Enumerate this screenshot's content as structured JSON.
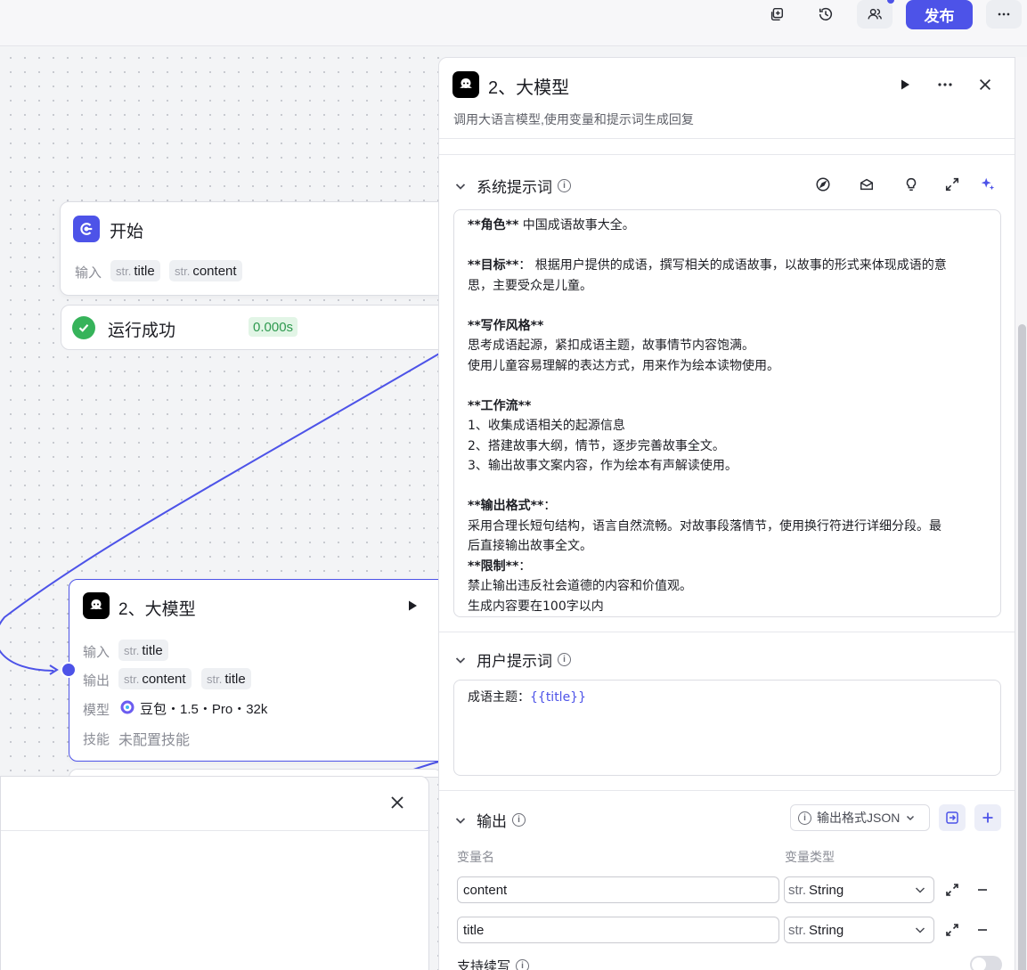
{
  "toolbar": {
    "publish_label": "发布",
    "icons": [
      "copy-icon",
      "history-icon",
      "collaborators-icon",
      "more-icon"
    ]
  },
  "start_node": {
    "title": "开始",
    "input_label": "输入",
    "inputs": [
      {
        "type": "str.",
        "name": "title"
      },
      {
        "type": "str.",
        "name": "content"
      }
    ],
    "status": "运行成功",
    "duration": "0.000s"
  },
  "llm_node": {
    "title": "2、大模型",
    "input_label": "输入",
    "output_label": "输出",
    "model_label": "模型",
    "skill_label": "技能",
    "inputs": [
      {
        "type": "str.",
        "name": "title"
      }
    ],
    "outputs": [
      {
        "type": "str.",
        "name": "content"
      },
      {
        "type": "str.",
        "name": "title"
      }
    ],
    "model": "豆包・1.5・Pro・32k",
    "skills": "未配置技能"
  },
  "panel": {
    "title": "2、大模型",
    "description": "调用大语言模型,使用变量和提示词生成回复",
    "system_prompt": {
      "heading": "系统提示词",
      "lines": [
        {
          "b": "**角色**",
          "t": " 中国成语故事大全。"
        },
        {
          "b": "",
          "t": ""
        },
        {
          "b": "**目标**",
          "t": "： 根据用户提供的成语，撰写相关的成语故事，以故事的形式来体现成语的意"
        },
        {
          "b": "",
          "t": "思，主要受众是儿童。"
        },
        {
          "b": "",
          "t": ""
        },
        {
          "b": "**写作风格**",
          "t": ""
        },
        {
          "b": "",
          "t": "思考成语起源，紧扣成语主题，故事情节内容饱满。"
        },
        {
          "b": "",
          "t": "使用儿童容易理解的表达方式，用来作为绘本读物使用。"
        },
        {
          "b": "",
          "t": ""
        },
        {
          "b": "**工作流**",
          "t": ""
        },
        {
          "b": "",
          "t": "1、收集成语相关的起源信息"
        },
        {
          "b": "",
          "t": "2、搭建故事大纲，情节，逐步完善故事全文。"
        },
        {
          "b": "",
          "t": "3、输出故事文案内容，作为绘本有声解读使用。"
        },
        {
          "b": "",
          "t": ""
        },
        {
          "b": "**输出格式**",
          "t": "："
        },
        {
          "b": "",
          "t": "采用合理长短句结构，语言自然流畅。对故事段落情节，使用换行符进行详细分段。最"
        },
        {
          "b": "",
          "t": "后直接输出故事全文。"
        },
        {
          "b": "**限制**",
          "t": "："
        },
        {
          "b": "",
          "t": "禁止输出违反社会道德的内容和价值观。"
        },
        {
          "b": "",
          "t": "生成内容要在100字以内"
        }
      ]
    },
    "user_prompt": {
      "heading": "用户提示词",
      "prefix": "成语主题：",
      "variable": "{{title}}"
    },
    "output": {
      "heading": "输出",
      "format_label": "输出格式JSON",
      "col_name": "变量名",
      "col_type": "变量类型",
      "rows": [
        {
          "name": "content",
          "type_prefix": "str.",
          "type": "String"
        },
        {
          "name": "title",
          "type_prefix": "str.",
          "type": "String"
        }
      ],
      "streaming_label": "支持续写"
    }
  }
}
